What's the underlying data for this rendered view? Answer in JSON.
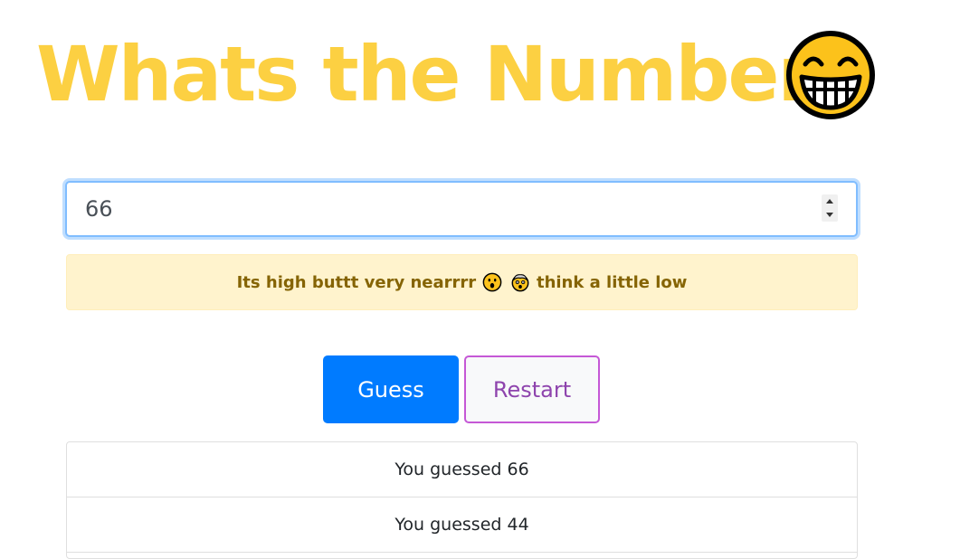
{
  "title": "Whats the Number?",
  "title_icon": "grinning-face-icon",
  "colors": {
    "title": "#fcd042",
    "input_focus": "#80bdff",
    "alert_bg": "#fff3cd",
    "alert_text": "#856404",
    "guess_button": "#007bff",
    "restart_border": "#c558d6",
    "restart_text": "#8e44ad"
  },
  "input": {
    "value": "66",
    "type": "number"
  },
  "alert": {
    "text_before": "Its high buttt very nearrrr",
    "emojis": [
      "astonished-face-icon",
      "exploding-head-icon"
    ],
    "text_after": "think a little low"
  },
  "buttons": {
    "guess": "Guess",
    "restart": "Restart"
  },
  "history": [
    "You guessed 66",
    "You guessed 44"
  ]
}
